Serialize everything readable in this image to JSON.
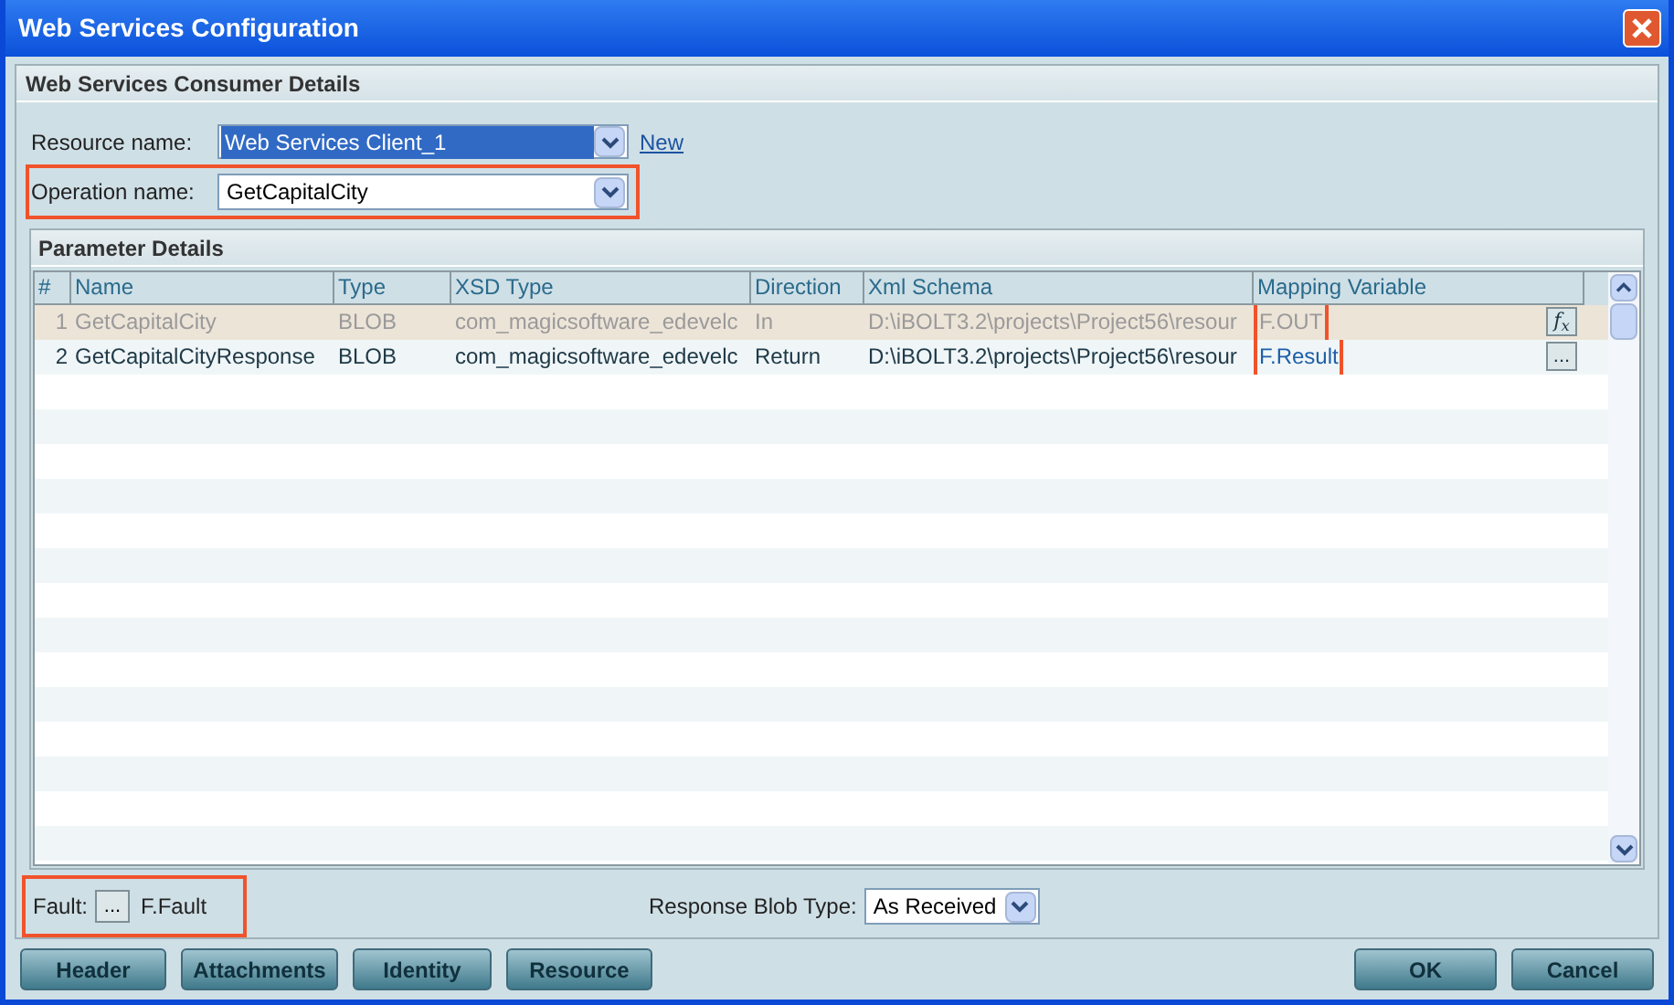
{
  "window": {
    "title": "Web Services Configuration"
  },
  "consumer_details": {
    "title": "Web Services Consumer Details",
    "resource": {
      "label": "Resource name:",
      "value": "Web Services Client_1",
      "selected": true,
      "link": "New"
    },
    "operation": {
      "label": "Operation name:",
      "value": "GetCapitalCity",
      "highlighted": true
    }
  },
  "parameter_details": {
    "title": "Parameter Details",
    "columns": [
      "#",
      "Name",
      "Type",
      "XSD Type",
      "Direction",
      "Xml Schema",
      "Mapping Variable"
    ],
    "rows": [
      {
        "cells": [
          "1",
          "GetCapitalCity",
          "BLOB",
          "com_magicsoftware_edevelc",
          "In",
          "D:\\iBOLT3.2\\projects\\Project56\\resour",
          "F.OUT"
        ],
        "selected": true,
        "action": {
          "kind": "formula",
          "label": "*f*$_{x}$"
        }
      },
      {
        "cells": [
          "2",
          "GetCapitalCityResponse",
          "BLOB",
          "com_magicsoftware_edevelc",
          "Return",
          "D:\\iBOLT3.2\\projects\\Project56\\resour",
          "F.Result"
        ],
        "selected": false,
        "action": {
          "kind": "browse",
          "label": "..."
        }
      }
    ],
    "mapping_highlighted": true
  },
  "fault": {
    "label": "Fault:",
    "button": "...",
    "value": "F.Fault",
    "highlighted": true
  },
  "response_blob": {
    "label": "Response Blob Type:",
    "value": "As Received"
  },
  "buttons_left": [
    "Header",
    "Attachments",
    "Identity",
    "Resource"
  ],
  "buttons_right": [
    "OK",
    "Cancel"
  ]
}
